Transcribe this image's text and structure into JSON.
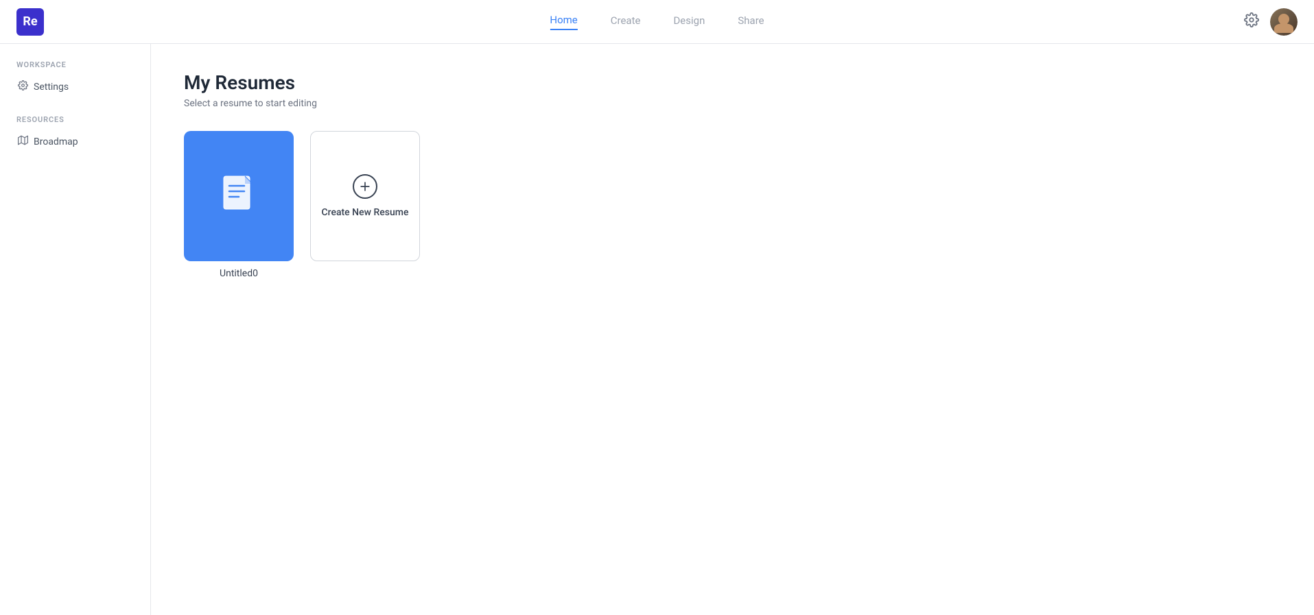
{
  "app": {
    "logo_text": "Re",
    "logo_bg": "#3b30cc"
  },
  "nav": {
    "links": [
      {
        "id": "home",
        "label": "Home",
        "active": true
      },
      {
        "id": "create",
        "label": "Create",
        "active": false
      },
      {
        "id": "design",
        "label": "Design",
        "active": false
      },
      {
        "id": "share",
        "label": "Share",
        "active": false
      }
    ]
  },
  "sidebar": {
    "workspace_label": "WORKSPACE",
    "resources_label": "RESOURCES",
    "items_workspace": [
      {
        "id": "settings",
        "label": "Settings",
        "icon": "⚙"
      }
    ],
    "items_resources": [
      {
        "id": "broadmap",
        "label": "Broadmap",
        "icon": "📖"
      }
    ]
  },
  "main": {
    "title": "My Resumes",
    "subtitle": "Select a resume to start editing",
    "resumes": [
      {
        "id": "untitled0",
        "name": "Untitled0"
      }
    ],
    "create_new_label": "Create New Resume"
  }
}
